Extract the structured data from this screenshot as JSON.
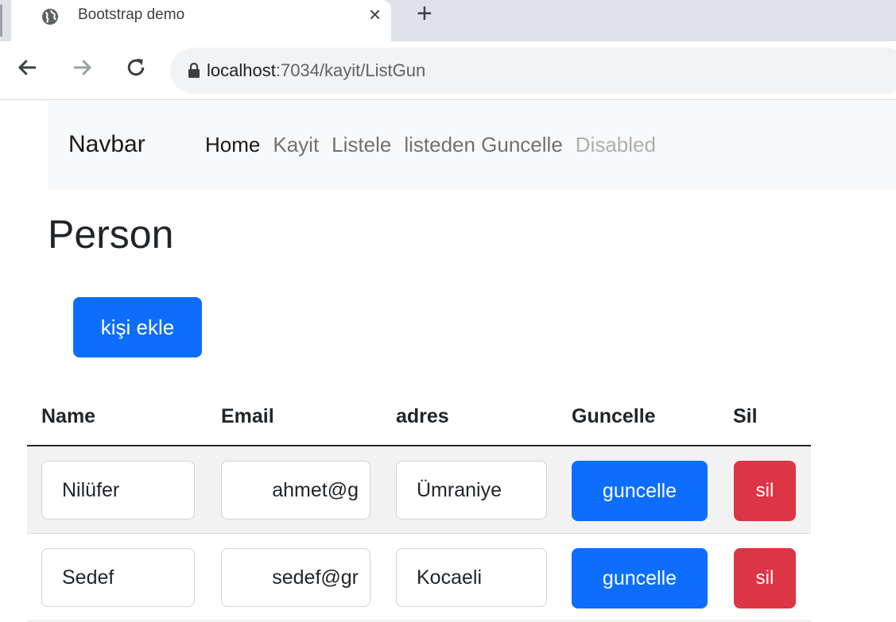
{
  "browser": {
    "tab_title": "Bootstrap demo",
    "close_glyph": "×",
    "newtab_glyph": "+",
    "url_host": "localhost",
    "url_path": ":7034/kayit/ListGun",
    "icons": {
      "favicon": "globe-icon",
      "back": "arrow-left-icon",
      "forward": "arrow-right-icon",
      "reload": "reload-icon",
      "secure": "lock-icon"
    }
  },
  "navbar": {
    "brand": "Navbar",
    "links": [
      {
        "label": "Home",
        "state": "active"
      },
      {
        "label": "Kayit",
        "state": "normal"
      },
      {
        "label": "Listele",
        "state": "normal"
      },
      {
        "label": "listeden Guncelle",
        "state": "normal"
      },
      {
        "label": "Disabled",
        "state": "disabled"
      }
    ]
  },
  "page": {
    "title": "Person",
    "add_button": "kişi ekle"
  },
  "table": {
    "headers": [
      "Name",
      "Email",
      "adres",
      "Guncelle",
      "Sil"
    ],
    "rows": [
      {
        "name": "Nilüfer",
        "email": "ahmet@g",
        "adres": "Ümraniye",
        "update_label": "guncelle",
        "delete_label": "sil"
      },
      {
        "name": "Sedef",
        "email": "sedef@gr",
        "adres": "Kocaeli",
        "update_label": "guncelle",
        "delete_label": "sil"
      }
    ]
  },
  "colors": {
    "primary": "#0d6efd",
    "danger": "#dc3545",
    "navbar_bg": "#f8f9fa",
    "stripe": "#f2f2f2"
  }
}
